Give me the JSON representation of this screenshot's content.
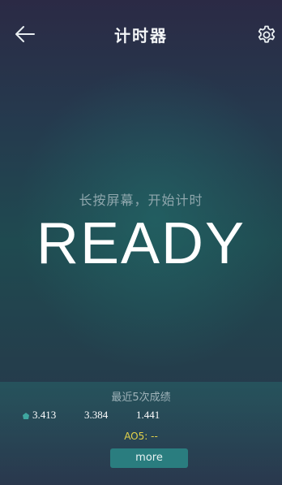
{
  "header": {
    "title": "计时器",
    "back_icon": "arrow-left-icon",
    "settings_icon": "gear-icon"
  },
  "main": {
    "hint": "长按屏幕，开始计时",
    "status": "READY"
  },
  "results": {
    "title": "最近5次成绩",
    "times": [
      "3.413",
      "3.384",
      "1.441"
    ],
    "best_marker_icon": "best-marker-icon",
    "ao5_label": "AO5: --",
    "more_label": "more"
  },
  "colors": {
    "accent": "#2a7d7f",
    "ao5": "#e4d34a"
  }
}
